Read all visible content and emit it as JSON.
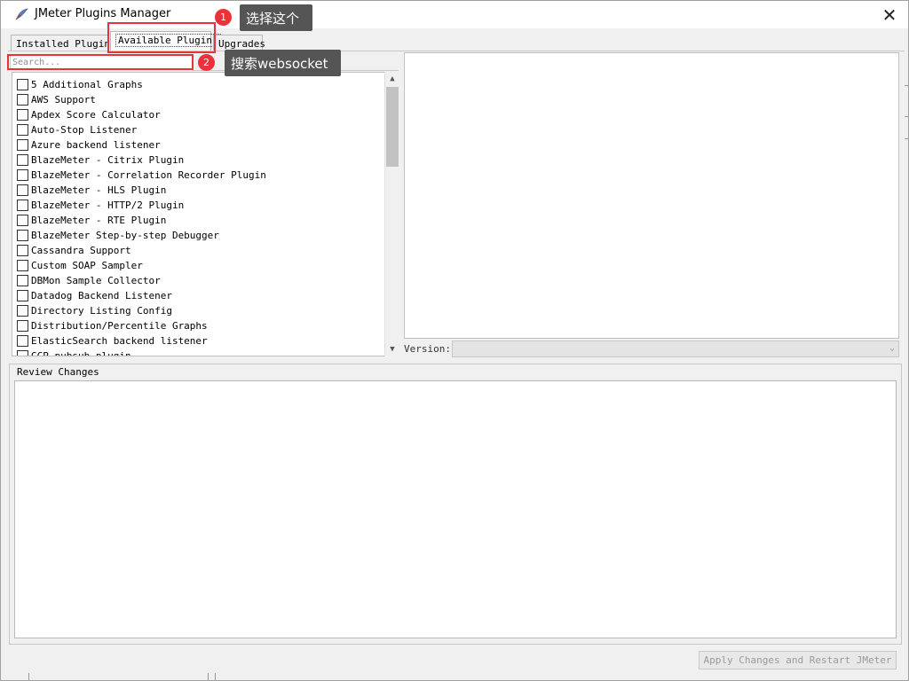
{
  "window": {
    "title": "JMeter Plugins Manager",
    "close_glyph": "✕"
  },
  "tabs": [
    {
      "label": "Installed Plugins",
      "active": false
    },
    {
      "label": "Available Plugins",
      "active": true
    },
    {
      "label": "Upgrades",
      "active": false
    }
  ],
  "search": {
    "placeholder": "Search...",
    "value": ""
  },
  "plugins": [
    {
      "label": "5 Additional Graphs",
      "checked": false
    },
    {
      "label": "AWS Support",
      "checked": false
    },
    {
      "label": "Apdex Score Calculator",
      "checked": false
    },
    {
      "label": "Auto-Stop Listener",
      "checked": false
    },
    {
      "label": "Azure backend listener",
      "checked": false
    },
    {
      "label": "BlazeMeter - Citrix Plugin",
      "checked": false
    },
    {
      "label": "BlazeMeter - Correlation Recorder Plugin",
      "checked": false
    },
    {
      "label": "BlazeMeter - HLS Plugin",
      "checked": false
    },
    {
      "label": "BlazeMeter - HTTP/2 Plugin",
      "checked": false
    },
    {
      "label": "BlazeMeter - RTE Plugin",
      "checked": false
    },
    {
      "label": "BlazeMeter Step-by-step Debugger",
      "checked": false
    },
    {
      "label": "Cassandra Support",
      "checked": false
    },
    {
      "label": "Custom SOAP Sampler",
      "checked": false
    },
    {
      "label": "DBMon Sample Collector",
      "checked": false
    },
    {
      "label": "Datadog Backend Listener",
      "checked": false
    },
    {
      "label": "Directory Listing Config",
      "checked": false
    },
    {
      "label": "Distribution/Percentile Graphs",
      "checked": false
    },
    {
      "label": "ElasticSearch backend listener",
      "checked": false
    },
    {
      "label": "GCP pubsub plugin",
      "checked": false
    }
  ],
  "scrollbar": {
    "up_glyph": "▲",
    "down_glyph": "▼"
  },
  "version": {
    "label": "Version:",
    "value": "",
    "chevron": "⌄"
  },
  "review": {
    "title": "Review Changes",
    "content": ""
  },
  "apply_button": {
    "label": "Apply Changes and Restart JMeter",
    "enabled": false
  },
  "annotations": {
    "step1": {
      "number": "1",
      "text": "选择这个"
    },
    "step2": {
      "number": "2",
      "text": "搜索websocket"
    },
    "color": "#e8333a",
    "callout_bg": "#555555"
  }
}
